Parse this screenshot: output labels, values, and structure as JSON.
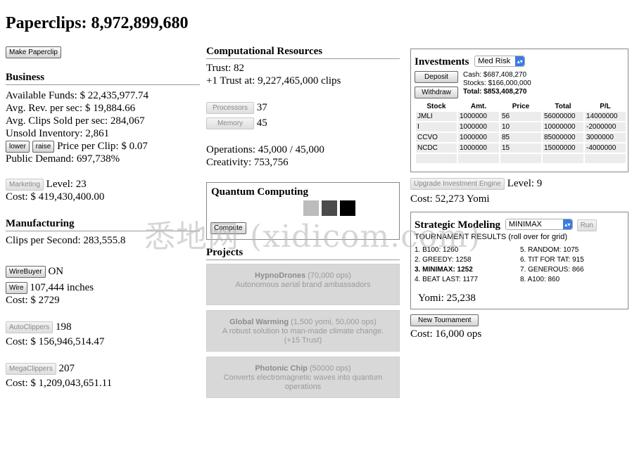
{
  "title": "Paperclips: 8,972,899,680",
  "make_paperclip": "Make Paperclip",
  "business": {
    "heading": "Business",
    "funds": "Available Funds: $ 22,435,977.74",
    "rev": "Avg. Rev. per sec: $ 19,884.66",
    "sold": "Avg. Clips Sold per sec: 284,067",
    "unsold": "Unsold Inventory: 2,861",
    "lower": "lower",
    "raise": "raise",
    "price": "Price per Clip: $ 0.07",
    "demand": "Public Demand: 697,738%",
    "marketing_btn": "Marketing",
    "marketing_level": "Level: 23",
    "marketing_cost": "Cost: $ 419,430,400.00"
  },
  "manufacturing": {
    "heading": "Manufacturing",
    "cps": "Clips per Second: 283,555.8",
    "wirebuyer_btn": "WireBuyer",
    "wirebuyer_state": "ON",
    "wire_btn": "Wire",
    "wire_amount": "107,444 inches",
    "wire_cost": "Cost: $ 2729",
    "autoclippers_btn": "AutoClippers",
    "autoclippers_count": "198",
    "autoclippers_cost": "Cost: $ 156,946,514.47",
    "megaclippers_btn": "MegaClippers",
    "megaclippers_count": "207",
    "megaclippers_cost": "Cost: $ 1,209,043,651.11"
  },
  "computational": {
    "heading": "Computational Resources",
    "trust": "Trust: 82",
    "next_trust": "+1 Trust at: 9,227,465,000 clips",
    "processors_btn": "Processors",
    "processors": "37",
    "memory_btn": "Memory",
    "memory": "45",
    "operations": "Operations: 45,000 / 45,000",
    "creativity": "Creativity: 753,756"
  },
  "quantum": {
    "heading": "Quantum Computing",
    "compute_btn": "Compute",
    "chip_colors": [
      "#bcbcbc",
      "#4a4a4a",
      "#000000"
    ]
  },
  "projects": {
    "heading": "Projects",
    "items": [
      {
        "name": "HypnoDrones",
        "cost": " (70,000 ops)",
        "desc": "Autonomous aerial brand ambassadors"
      },
      {
        "name": "Global Warming",
        "cost": " (1,500 yomi, 50,000 ops)",
        "desc": "A robust solution to man-made climate change. (+15 Trust)"
      },
      {
        "name": "Photonic Chip",
        "cost": " (50000 ops)",
        "desc": "Converts electromagnetic waves into quantum operations"
      }
    ]
  },
  "investments": {
    "heading": "Investments",
    "risk": "Med Risk",
    "deposit": "Deposit",
    "withdraw": "Withdraw",
    "cash": "Cash: $687,408,270",
    "stocks": "Stocks: $166,000,000",
    "total": "Total: $853,408,270",
    "columns": [
      "Stock",
      "Amt.",
      "Price",
      "Total",
      "P/L"
    ],
    "rows": [
      [
        "JMLI",
        "1000000",
        "56",
        "56000000",
        "14000000"
      ],
      [
        "I",
        "1000000",
        "10",
        "10000000",
        "-2000000"
      ],
      [
        "CCVO",
        "1000000",
        "85",
        "85000000",
        "3000000"
      ],
      [
        "NCDC",
        "1000000",
        "15",
        "15000000",
        "-4000000"
      ],
      [
        "",
        "",
        "",
        "",
        ""
      ]
    ],
    "upgrade_btn": "Upgrade Investment Engine",
    "level": "Level: 9",
    "upgrade_cost": "Cost: 52,273 Yomi"
  },
  "strategic": {
    "heading": "Strategic Modeling",
    "strategy": "MINIMAX",
    "run": "Run",
    "results_title": "TOURNAMENT RESULTS (roll over for grid)",
    "results_left": [
      "1. B100: 1260",
      "2. GREEDY: 1258",
      "3. MINIMAX: 1252",
      "4. BEAT LAST: 1177"
    ],
    "results_right": [
      "5. RANDOM: 1075",
      "6. TIT FOR TAT: 915",
      "7. GENEROUS: 866",
      "8. A100: 860"
    ],
    "yomi": "Yomi: 25,238",
    "new_tournament": "New Tournament",
    "tournament_cost": "Cost: 16,000 ops"
  },
  "watermark": "悉地网 (xidicom.com)"
}
